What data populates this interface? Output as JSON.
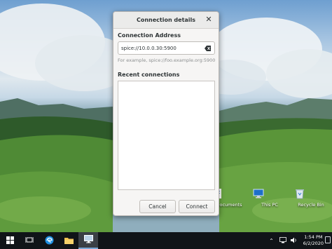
{
  "dialog": {
    "title": "Connection details",
    "address_label": "Connection Address",
    "address_value": "spice://10.0.0.30:5900",
    "address_hint": "For example, spice://foo.example.org:5900",
    "recent_label": "Recent connections",
    "recent_items": [],
    "cancel_label": "Cancel",
    "connect_label": "Connect"
  },
  "desktop_icons": [
    {
      "label": "Documents",
      "icon": "document-icon"
    },
    {
      "label": "This PC",
      "icon": "computer-icon"
    },
    {
      "label": "Recycle Bin",
      "icon": "recycle-bin-icon"
    }
  ],
  "taskbar": {
    "items": [
      "start-icon",
      "task-view-icon",
      "edge-icon",
      "file-explorer-icon",
      "remote-viewer-icon"
    ],
    "active_item": "remote-viewer-icon",
    "time": "1:54 PM",
    "date": "6/2/2020",
    "tray_icons": [
      "chevron-up-icon",
      "network-icon",
      "volume-icon",
      "notification-icon"
    ]
  },
  "colors": {
    "taskbar_bg": "#101418",
    "dialog_bg": "#f6f5f4",
    "sky": "#a9c6e2",
    "grass": "#4f8a35"
  }
}
